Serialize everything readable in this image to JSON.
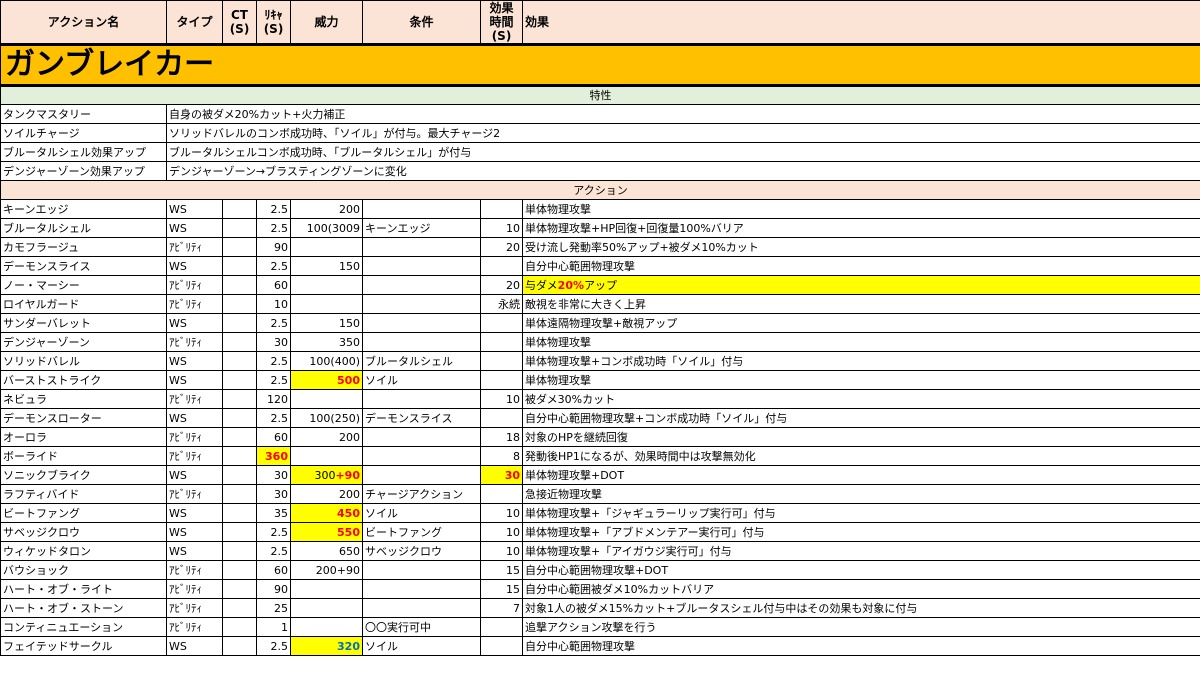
{
  "headers": {
    "name": "アクション名",
    "type": "タイプ",
    "ct": "CT\n(S)",
    "recast": "ﾘｷｬ\n(S)",
    "potency": "威力",
    "cond": "条件",
    "duration": "効果\n時間\n(S)",
    "effect": "効果"
  },
  "job_title": "ガンブレイカー",
  "traits_section": "特性",
  "traits": [
    {
      "name": "タンクマスタリー",
      "desc": "自身の被ダメ20%カット+火力補正"
    },
    {
      "name": "ソイルチャージ",
      "desc": "ソリッドバレルのコンボ成功時、「ソイル」が付与。最大チャージ2"
    },
    {
      "name": "ブルータルシェル効果アップ",
      "desc": "ブルータルシェルコンボ成功時、「ブルータルシェル」が付与"
    },
    {
      "name": "デンジャーゾーン効果アップ",
      "desc": "デンジャーゾーン→ブラスティングゾーンに変化"
    }
  ],
  "actions_section": "アクション",
  "actions": [
    {
      "name": "キーンエッジ",
      "type": "WS",
      "ct": "",
      "recast": "2.5",
      "potency": "200",
      "cond": "",
      "duration": "",
      "effect": "単体物理攻撃"
    },
    {
      "name": "ブルータルシェル",
      "type": "WS",
      "ct": "",
      "recast": "2.5",
      "potency": "100(3009",
      "cond": "キーンエッジ",
      "duration": "10",
      "effect": "単体物理攻撃+HP回復+回復量100%バリア"
    },
    {
      "name": "カモフラージュ",
      "type": "ｱﾋﾞﾘﾃｨ",
      "ct": "",
      "recast": "90",
      "potency": "",
      "cond": "",
      "duration": "20",
      "effect": "受け流し発動率50%アップ+被ダメ10%カット"
    },
    {
      "name": "デーモンスライス",
      "type": "WS",
      "ct": "",
      "recast": "2.5",
      "potency": "150",
      "cond": "",
      "duration": "",
      "effect": "自分中心範囲物理攻撃"
    },
    {
      "name": "ノー・マーシー",
      "type": "ｱﾋﾞﾘﾃｨ",
      "ct": "",
      "recast": "60",
      "potency": "",
      "cond": "",
      "duration": "20",
      "effect_pre": "与ダメ",
      "effect_hl": "20%",
      "effect_post": "アップ",
      "effect_style": "yellow"
    },
    {
      "name": "ロイヤルガード",
      "type": "ｱﾋﾞﾘﾃｨ",
      "ct": "",
      "recast": "10",
      "potency": "",
      "cond": "",
      "duration": "永続",
      "effect": "敵視を非常に大きく上昇"
    },
    {
      "name": "サンダーバレット",
      "type": "WS",
      "ct": "",
      "recast": "2.5",
      "potency": "150",
      "cond": "",
      "duration": "",
      "effect": "単体遠隔物理攻撃+敵視アップ"
    },
    {
      "name": "デンジャーゾーン",
      "type": "ｱﾋﾞﾘﾃｨ",
      "ct": "",
      "recast": "30",
      "potency": "350",
      "cond": "",
      "duration": "",
      "effect": "単体物理攻撃"
    },
    {
      "name": "ソリッドバレル",
      "type": "WS",
      "ct": "",
      "recast": "2.5",
      "potency": "100(400)",
      "cond": "ブルータルシェル",
      "duration": "",
      "effect": "単体物理攻撃+コンボ成功時「ソイル」付与"
    },
    {
      "name": "バーストストライク",
      "type": "WS",
      "ct": "",
      "recast": "2.5",
      "potency": "500",
      "potency_style": "hl-red",
      "cond": "ソイル",
      "duration": "",
      "effect": "単体物理攻撃"
    },
    {
      "name": "ネビュラ",
      "type": "ｱﾋﾞﾘﾃｨ",
      "ct": "",
      "recast": "120",
      "potency": "",
      "cond": "",
      "duration": "10",
      "effect": "被ダメ30%カット"
    },
    {
      "name": "デーモンスローター",
      "type": "WS",
      "ct": "",
      "recast": "2.5",
      "potency": "100(250)",
      "cond": "デーモンスライス",
      "duration": "",
      "effect": "自分中心範囲物理攻撃+コンボ成功時「ソイル」付与"
    },
    {
      "name": "オーロラ",
      "type": "ｱﾋﾞﾘﾃｨ",
      "ct": "",
      "recast": "60",
      "potency": "200",
      "cond": "",
      "duration": "18",
      "effect": "対象のHPを継続回復"
    },
    {
      "name": "ボーライド",
      "type": "ｱﾋﾞﾘﾃｨ",
      "ct": "",
      "recast": "360",
      "recast_style": "hl-red",
      "potency": "",
      "cond": "",
      "duration": "8",
      "effect": "発動後HP1になるが、効果時間中は攻撃無効化"
    },
    {
      "name": "ソニックブライク",
      "type": "WS",
      "ct": "",
      "recast": "30",
      "potency_pre": "300",
      "potency_plus": "+90",
      "potency_style": "hl-mix",
      "cond": "",
      "duration": "30",
      "duration_style": "hl-red",
      "effect": "単体物理攻撃+DOT"
    },
    {
      "name": "ラフティバイド",
      "type": "ｱﾋﾞﾘﾃｨ",
      "ct": "",
      "recast": "30",
      "potency": "200",
      "cond": "チャージアクション",
      "duration": "",
      "effect": "急接近物理攻撃"
    },
    {
      "name": "ビートファング",
      "type": "WS",
      "ct": "",
      "recast": "35",
      "potency": "450",
      "potency_style": "hl-red",
      "cond": "ソイル",
      "duration": "10",
      "effect": "単体物理攻撃+「ジャギュラーリップ実行可」付与"
    },
    {
      "name": "サベッジクロウ",
      "type": "WS",
      "ct": "",
      "recast": "2.5",
      "potency": "550",
      "potency_style": "hl-red",
      "cond": "ビートファング",
      "duration": "10",
      "effect": "単体物理攻撃+「アブドメンテアー実行可」付与"
    },
    {
      "name": "ウィケッドタロン",
      "type": "WS",
      "ct": "",
      "recast": "2.5",
      "potency": "650",
      "cond": "サベッジクロウ",
      "duration": "10",
      "effect": "単体物理攻撃+「アイガウジ実行可」付与"
    },
    {
      "name": "バウショック",
      "type": "ｱﾋﾞﾘﾃｨ",
      "ct": "",
      "recast": "60",
      "potency": "200+90",
      "cond": "",
      "duration": "15",
      "effect": "自分中心範囲物理攻撃+DOT"
    },
    {
      "name": "ハート・オブ・ライト",
      "type": "ｱﾋﾞﾘﾃｨ",
      "ct": "",
      "recast": "90",
      "potency": "",
      "cond": "",
      "duration": "15",
      "effect": "自分中心範囲被ダメ10%カットバリア"
    },
    {
      "name": "ハート・オブ・ストーン",
      "type": "ｱﾋﾞﾘﾃｨ",
      "ct": "",
      "recast": "25",
      "potency": "",
      "cond": "",
      "duration": "7",
      "effect": "対象1人の被ダメ15%カット+ブルータスシェル付与中はその効果も対象に付与"
    },
    {
      "name": "コンティニュエーション",
      "type": "ｱﾋﾞﾘﾃｨ",
      "ct": "",
      "recast": "1",
      "potency": "",
      "cond": "〇〇実行可中",
      "duration": "",
      "effect": "追撃アクション攻撃を行う"
    },
    {
      "name": "フェイテッドサークル",
      "type": "WS",
      "ct": "",
      "recast": "2.5",
      "potency": "320",
      "potency_style": "hl-blue",
      "cond": "ソイル",
      "duration": "",
      "effect": "自分中心範囲物理攻撃"
    }
  ]
}
